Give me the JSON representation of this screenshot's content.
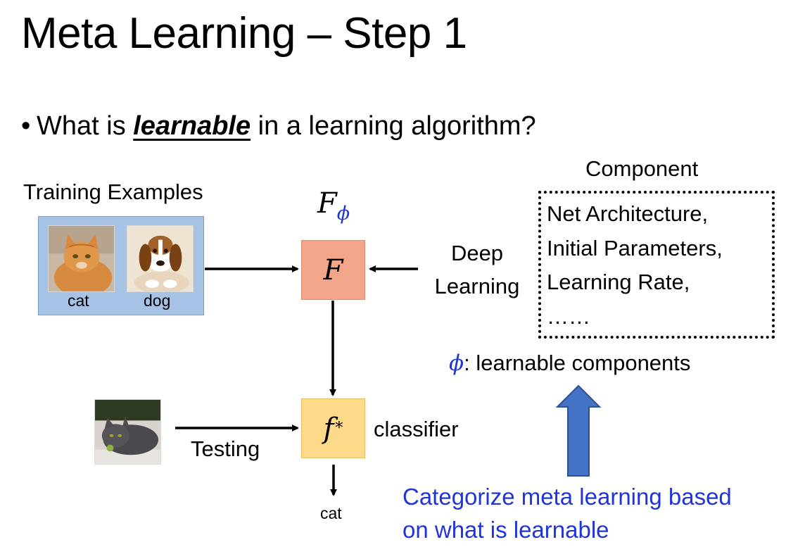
{
  "title": "Meta Learning – Step 1",
  "bullet": {
    "prefix": "What is ",
    "emphasis": "learnable",
    "suffix": " in a learning algorithm?"
  },
  "training": {
    "label": "Training Examples",
    "examples": [
      {
        "label": "cat"
      },
      {
        "label": "dog"
      }
    ]
  },
  "function": {
    "F_phi_main": "F",
    "F_phi_sub": "ϕ",
    "F_box": "F",
    "f_star_main": "f",
    "f_star_sup": "*"
  },
  "deep_learning": {
    "line1": "Deep",
    "line2": "Learning"
  },
  "component": {
    "heading": "Component",
    "items": [
      "Net Architecture,",
      "Initial Parameters,",
      "Learning Rate,",
      "……"
    ]
  },
  "phi_note": {
    "symbol": "ϕ",
    "text": ": learnable components"
  },
  "classifier_label": "classifier",
  "testing_label": "Testing",
  "output_label": "cat",
  "categorize": {
    "line1": "Categorize meta learning based",
    "line2": "on what is learnable"
  },
  "colors": {
    "blue_text": "#1f35d6",
    "training_box": "#a6c3e6",
    "F_box": "#f2a589",
    "f_star_box": "#fdd98a",
    "up_arrow": "#4472c4"
  }
}
